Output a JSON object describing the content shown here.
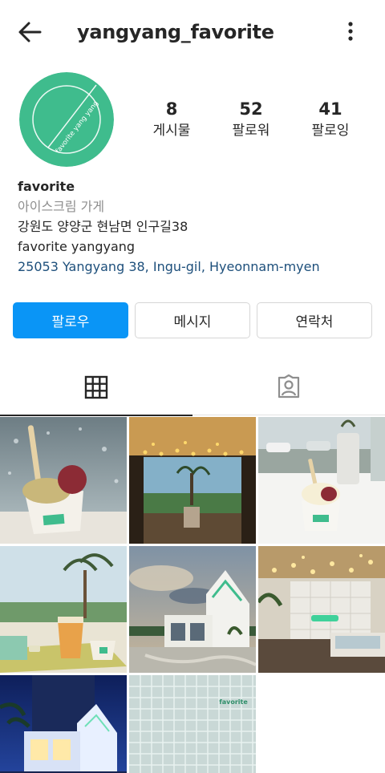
{
  "header": {
    "username": "yangyang_favorite",
    "back_icon": "arrow-left-icon",
    "more_icon": "more-vertical-icon"
  },
  "profile": {
    "avatar": {
      "text": "favorite yang yang",
      "color": "#3fbc8d"
    },
    "stats": [
      {
        "value": "8",
        "label": "게시물"
      },
      {
        "value": "52",
        "label": "팔로워"
      },
      {
        "value": "41",
        "label": "팔로잉"
      }
    ],
    "bio": {
      "name": "favorite",
      "category": "아이스크림 가게",
      "address": "강원도 양양군 현남면 인구길38",
      "line": "favorite yangyang",
      "link": "25053 Yangyang 38, Ingu-gil, Hyeonnam-myen"
    }
  },
  "actions": {
    "follow": "팔로우",
    "message": "메시지",
    "contact": "연락처"
  },
  "tabs": [
    {
      "icon": "grid-icon",
      "active": true
    },
    {
      "icon": "tagged-person-icon",
      "active": false
    }
  ],
  "posts": [
    {
      "name": "post-ice-cream-window"
    },
    {
      "name": "post-cafe-interior-lights"
    },
    {
      "name": "post-ice-cream-table"
    },
    {
      "name": "post-coffee-cups-tray"
    },
    {
      "name": "post-building-exterior"
    },
    {
      "name": "post-counter-neon"
    },
    {
      "name": "post-building-night"
    },
    {
      "name": "post-tile-wall-logo",
      "text": "favorite"
    }
  ],
  "colors": {
    "accent": "#0a95f6",
    "link": "#1d4f7b",
    "brand_green": "#3fbc8d"
  }
}
